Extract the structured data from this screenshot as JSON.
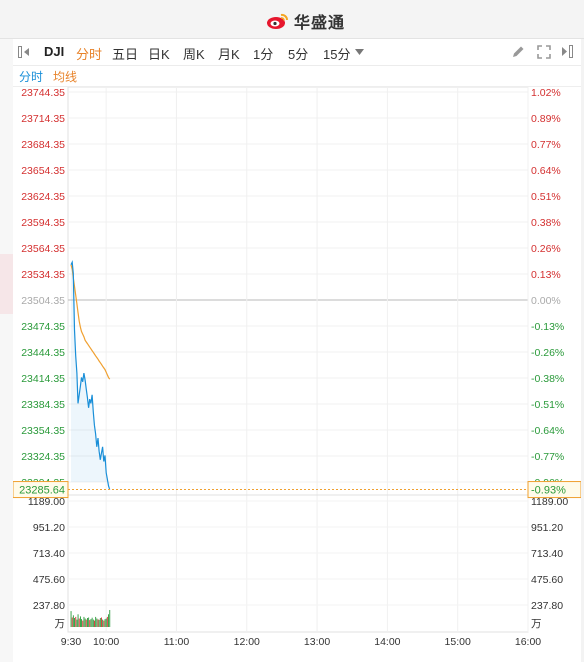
{
  "brand": {
    "name": "华盛通"
  },
  "toolbar": {
    "symbol": "DJI",
    "tabs": [
      "分时",
      "五日",
      "日K",
      "周K",
      "月K",
      "1分",
      "5分",
      "15分"
    ],
    "active_tab": "分时"
  },
  "subtabs": {
    "time": "分时",
    "avg": "均线"
  },
  "colors": {
    "up": "#d43030",
    "down": "#2a9a3a",
    "price_line": "#1a8fd8",
    "avg_line": "#f0a030",
    "accent": "#e8832a",
    "base": "#999999"
  },
  "chart_data": {
    "type": "line",
    "price_axis": {
      "labels": [
        "23744.35",
        "23714.35",
        "23684.35",
        "23654.35",
        "23624.35",
        "23594.35",
        "23564.35",
        "23534.35",
        "23504.35",
        "23474.35",
        "23444.35",
        "23414.35",
        "23384.35",
        "23354.35",
        "23324.35",
        "23294.35"
      ],
      "pct_labels": [
        "1.02%",
        "0.89%",
        "0.77%",
        "0.64%",
        "0.51%",
        "0.38%",
        "0.26%",
        "0.13%",
        "0.00%",
        "-0.13%",
        "-0.26%",
        "-0.38%",
        "-0.51%",
        "-0.64%",
        "-0.77%",
        "-0.90%"
      ],
      "base": 23504.35,
      "ylim": [
        23294.35,
        23744.35
      ]
    },
    "current": {
      "price": "23285.64",
      "pct": "-0.93%"
    },
    "volume_axis": {
      "labels": [
        "1189.00",
        "951.20",
        "713.40",
        "475.60",
        "237.80"
      ],
      "unit": "万",
      "ylim": [
        0,
        1189.0
      ]
    },
    "time_axis": {
      "labels": [
        "9:30",
        "10:00",
        "11:00",
        "12:00",
        "13:00",
        "14:00",
        "15:00",
        "16:00"
      ]
    },
    "price_series": [
      23545,
      23548,
      23535,
      23470,
      23440,
      23420,
      23385,
      23395,
      23405,
      23415,
      23410,
      23420,
      23412,
      23402,
      23392,
      23380,
      23390,
      23385,
      23395,
      23375,
      23360,
      23350,
      23335,
      23345,
      23330,
      23320,
      23328,
      23335,
      23318,
      23325,
      23305,
      23298,
      23290,
      23285.64
    ],
    "avg_series": [
      23545,
      23540,
      23530,
      23520,
      23510,
      23500,
      23490,
      23480,
      23473,
      23468,
      23465,
      23462,
      23458,
      23456,
      23454,
      23452,
      23450,
      23448,
      23446,
      23444,
      23442,
      23440,
      23438,
      23436,
      23434,
      23432,
      23430,
      23428,
      23426,
      23424,
      23421,
      23418,
      23415,
      23413
    ],
    "volume_series": [
      150,
      90,
      110,
      85,
      95,
      70,
      120,
      80,
      100,
      75,
      60,
      95,
      80,
      70,
      85,
      90,
      65,
      75,
      88,
      70,
      60,
      95,
      80,
      72,
      68,
      85,
      90,
      70,
      60,
      75,
      80,
      95,
      120,
      160
    ],
    "volume_colors": [
      "d",
      "u",
      "d",
      "d",
      "u",
      "d",
      "d",
      "u",
      "d",
      "d",
      "u",
      "d",
      "d",
      "u",
      "d",
      "d",
      "u",
      "d",
      "d",
      "d",
      "u",
      "d",
      "d",
      "u",
      "d",
      "d",
      "u",
      "d",
      "u",
      "d",
      "d",
      "u",
      "d",
      "d"
    ],
    "session_minutes": 390,
    "elapsed_minutes": 33
  }
}
